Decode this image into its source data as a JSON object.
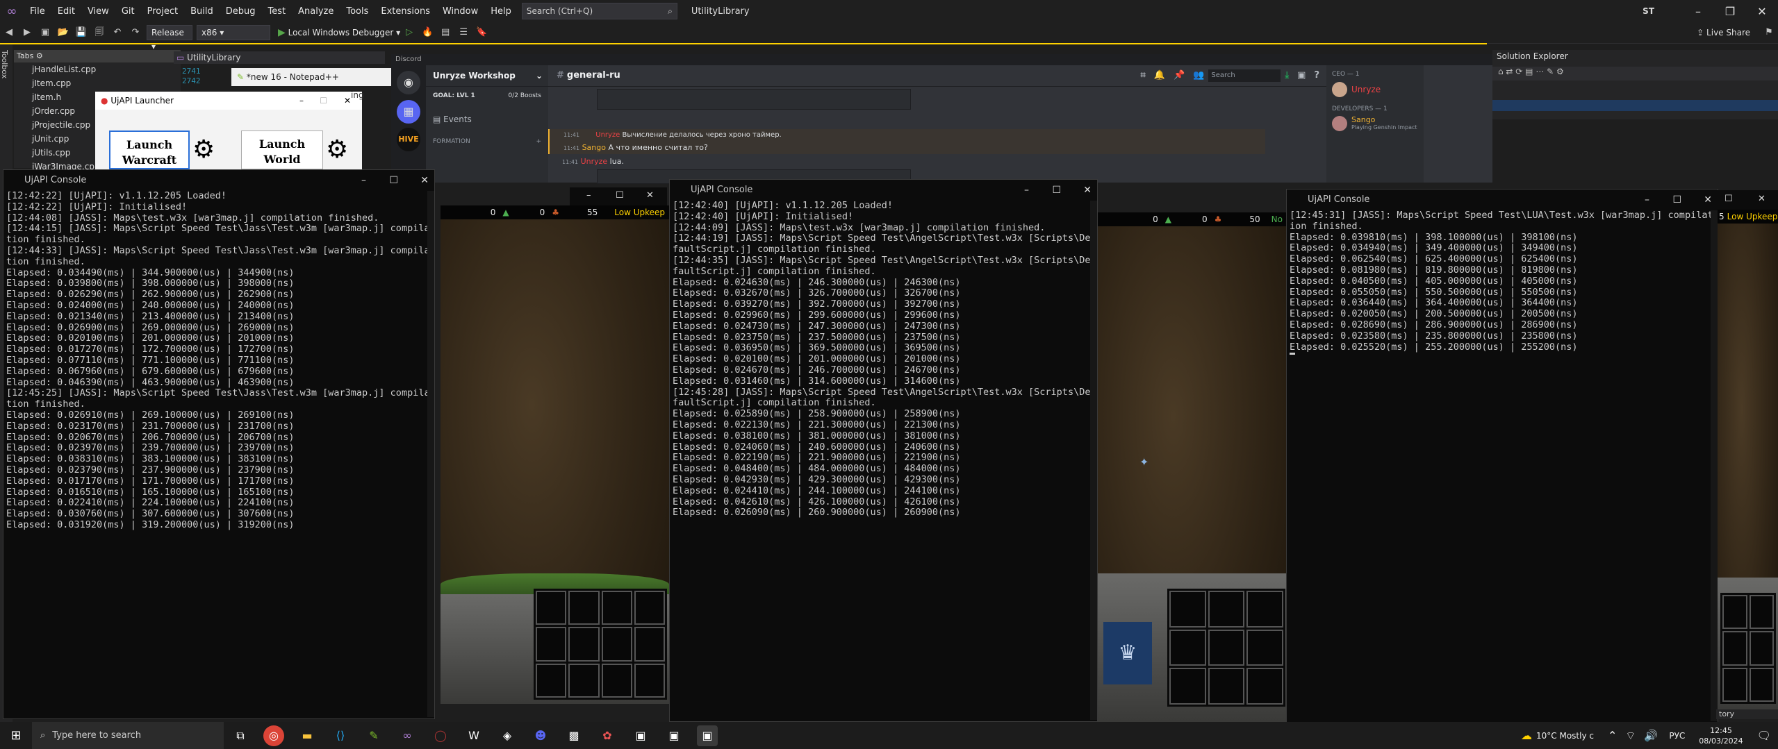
{
  "vs": {
    "menu": [
      "File",
      "Edit",
      "View",
      "Git",
      "Project",
      "Build",
      "Debug",
      "Test",
      "Analyze",
      "Tools",
      "Extensions",
      "Window",
      "Help"
    ],
    "search_placeholder": "Search (Ctrl+Q)",
    "solution_name": "UtilityLibrary",
    "user_initials": "ST",
    "live_share": "Live Share",
    "config": "Release",
    "platform": "x86",
    "debugger": "Local Windows Debugger",
    "tabs_label": "Tabs",
    "doc_tab": "UtilityLibrary",
    "solution_explorer": "Solution Explorer",
    "toolbox": "Toolbox",
    "line_numbers": [
      "2741",
      "2742"
    ],
    "files": [
      "jHandleList.cpp",
      "jItem.cpp",
      "jItem.h",
      "jOrder.cpp",
      "jProjectile.cpp",
      "jUnit.cpp",
      "jUtils.cpp",
      "jWar3Image.cpp"
    ],
    "bottom_tab": "tory"
  },
  "notepad": {
    "title": "*new 16 - Notepad++"
  },
  "launcher": {
    "title": "UjAPI Launcher",
    "btn1": "Launch Warcraft",
    "btn2": "Launch World Editor",
    "behind": "ing"
  },
  "discord": {
    "app": "Discord",
    "server": "Unryze Workshop",
    "goal": "GOAL: LVL 1",
    "boosts": "0/2 Boosts",
    "events": "Events",
    "category": "FORMATION",
    "channel": "general-ru",
    "search": "Search",
    "msg1_time": "11:41",
    "msg1_user": "Unryze",
    "msg1_text": "Вычисление делалось через хроно таймер.",
    "msg2_time": "11:41",
    "msg2_user": "Sango",
    "msg2_text": "А что именно считал то?",
    "msg3_time": "11:41",
    "msg3_user": "Unryze",
    "msg3_text": "lua.",
    "role1": "CEO — 1",
    "member1": "Unryze",
    "role2": "DEVELOPERS — 1",
    "member2": "Sango",
    "member2_status": "Playing Genshin Impact"
  },
  "console1": {
    "title": "UjAPI Console",
    "lines": [
      "[12:42:22] [UjAPI]: v1.1.12.205 Loaded!",
      "[12:42:22] [UjAPI]: Initialised!",
      "[12:44:08] [JASS]: Maps\\test.w3x [war3map.j] compilation finished.",
      "[12:44:15] [JASS]: Maps\\Script Speed Test\\Jass\\Test.w3m [war3map.j] compilation finished.",
      "[12:44:33] [JASS]: Maps\\Script Speed Test\\Jass\\Test.w3m [war3map.j] compilation finished.",
      "Elapsed: 0.034490(ms) | 344.900000(us) | 344900(ns)",
      "Elapsed: 0.039800(ms) | 398.000000(us) | 398000(ns)",
      "Elapsed: 0.026290(ms) | 262.900000(us) | 262900(ns)",
      "Elapsed: 0.024000(ms) | 240.000000(us) | 240000(ns)",
      "Elapsed: 0.021340(ms) | 213.400000(us) | 213400(ns)",
      "Elapsed: 0.026900(ms) | 269.000000(us) | 269000(ns)",
      "Elapsed: 0.020100(ms) | 201.000000(us) | 201000(ns)",
      "Elapsed: 0.017270(ms) | 172.700000(us) | 172700(ns)",
      "Elapsed: 0.077110(ms) | 771.100000(us) | 771100(ns)",
      "Elapsed: 0.067960(ms) | 679.600000(us) | 679600(ns)",
      "Elapsed: 0.046390(ms) | 463.900000(us) | 463900(ns)",
      "[12:45:25] [JASS]: Maps\\Script Speed Test\\Jass\\Test.w3m [war3map.j] compilation finished.",
      "Elapsed: 0.026910(ms) | 269.100000(us) | 269100(ns)",
      "Elapsed: 0.023170(ms) | 231.700000(us) | 231700(ns)",
      "Elapsed: 0.020670(ms) | 206.700000(us) | 206700(ns)",
      "Elapsed: 0.023970(ms) | 239.700000(us) | 239700(ns)",
      "Elapsed: 0.038310(ms) | 383.100000(us) | 383100(ns)",
      "Elapsed: 0.023790(ms) | 237.900000(us) | 237900(ns)",
      "Elapsed: 0.017170(ms) | 171.700000(us) | 171700(ns)",
      "Elapsed: 0.016510(ms) | 165.100000(us) | 165100(ns)",
      "Elapsed: 0.022410(ms) | 224.100000(us) | 224100(ns)",
      "Elapsed: 0.030760(ms) | 307.600000(us) | 307600(ns)",
      "Elapsed: 0.031920(ms) | 319.200000(us) | 319200(ns)"
    ]
  },
  "console2": {
    "title": "UjAPI Console",
    "lines": [
      "[12:42:40] [UjAPI]: v1.1.12.205 Loaded!",
      "[12:42:40] [UjAPI]: Initialised!",
      "[12:44:09] [JASS]: Maps\\test.w3x [war3map.j] compilation finished.",
      "[12:44:19] [JASS]: Maps\\Script Speed Test\\AngelScript\\Test.w3x [Scripts\\DefaultScript.j] compilation finished.",
      "[12:44:35] [JASS]: Maps\\Script Speed Test\\AngelScript\\Test.w3x [Scripts\\DefaultScript.j] compilation finished.",
      "Elapsed: 0.024630(ms) | 246.300000(us) | 246300(ns)",
      "Elapsed: 0.032670(ms) | 326.700000(us) | 326700(ns)",
      "Elapsed: 0.039270(ms) | 392.700000(us) | 392700(ns)",
      "Elapsed: 0.029960(ms) | 299.600000(us) | 299600(ns)",
      "Elapsed: 0.024730(ms) | 247.300000(us) | 247300(ns)",
      "Elapsed: 0.023750(ms) | 237.500000(us) | 237500(ns)",
      "Elapsed: 0.036950(ms) | 369.500000(us) | 369500(ns)",
      "Elapsed: 0.020100(ms) | 201.000000(us) | 201000(ns)",
      "Elapsed: 0.024670(ms) | 246.700000(us) | 246700(ns)",
      "Elapsed: 0.031460(ms) | 314.600000(us) | 314600(ns)",
      "[12:45:28] [JASS]: Maps\\Script Speed Test\\AngelScript\\Test.w3x [Scripts\\DefaultScript.j] compilation finished.",
      "Elapsed: 0.025890(ms) | 258.900000(us) | 258900(ns)",
      "Elapsed: 0.022130(ms) | 221.300000(us) | 221300(ns)",
      "Elapsed: 0.038100(ms) | 381.000000(us) | 381000(ns)",
      "Elapsed: 0.024060(ms) | 240.600000(us) | 240600(ns)",
      "Elapsed: 0.022190(ms) | 221.900000(us) | 221900(ns)",
      "Elapsed: 0.048400(ms) | 484.000000(us) | 484000(ns)",
      "Elapsed: 0.042930(ms) | 429.300000(us) | 429300(ns)",
      "Elapsed: 0.024410(ms) | 244.100000(us) | 244100(ns)",
      "Elapsed: 0.042610(ms) | 426.100000(us) | 426100(ns)",
      "Elapsed: 0.026090(ms) | 260.900000(us) | 260900(ns)"
    ]
  },
  "console3": {
    "title": "UjAPI Console",
    "lines": [
      "[12:45:31] [JASS]: Maps\\Script Speed Test\\LUA\\Test.w3x [war3map.j] compilation finished.",
      "Elapsed: 0.039810(ms) | 398.100000(us) | 398100(ns)",
      "Elapsed: 0.034940(ms) | 349.400000(us) | 349400(ns)",
      "Elapsed: 0.062540(ms) | 625.400000(us) | 625400(ns)",
      "Elapsed: 0.081980(ms) | 819.800000(us) | 819800(ns)",
      "Elapsed: 0.040500(ms) | 405.000000(us) | 405000(ns)",
      "Elapsed: 0.055050(ms) | 550.500000(us) | 550500(ns)",
      "Elapsed: 0.036440(ms) | 364.400000(us) | 364400(ns)",
      "Elapsed: 0.020050(ms) | 200.500000(us) | 200500(ns)",
      "Elapsed: 0.028690(ms) | 286.900000(us) | 286900(ns)",
      "Elapsed: 0.023580(ms) | 235.800000(us) | 235800(ns)",
      "Elapsed: 0.025520(ms) | 255.200000(us) | 255200(ns)"
    ]
  },
  "game1": {
    "gold": "0",
    "lumber": "0",
    "food": "55",
    "upkeep": "Low Upkeep"
  },
  "game2": {
    "gold": "0",
    "lumber": "0",
    "food": "50",
    "upkeep": "No"
  },
  "game3": {
    "food": "5",
    "upkeep": "Low Upkeep"
  },
  "taskbar": {
    "search": "Type here to search",
    "weather": "10°C  Mostly c",
    "lang": "РУС",
    "time": "12:45",
    "date": "08/03/2024"
  },
  "colors": {
    "accent": "#0078d4",
    "console_bg": "#0c0c0c",
    "console_text": "#cccccc",
    "upkeep": "#ffd200",
    "unryze": "#ed4245",
    "sango": "#f0b232"
  }
}
